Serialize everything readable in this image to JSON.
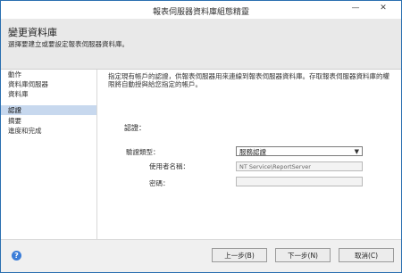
{
  "window": {
    "title": "報表伺服器資料庫組態精靈",
    "minimize_glyph": "—",
    "close_glyph": "✕"
  },
  "header": {
    "title": "變更資料庫",
    "subtitle": "選擇要建立或要設定報表伺服器資料庫。"
  },
  "steps": [
    {
      "label": "動作",
      "active": false
    },
    {
      "label": "資料庫伺服器",
      "active": false
    },
    {
      "label": "資料庫",
      "active": false
    },
    {
      "label": "認證",
      "active": true
    },
    {
      "label": "摘要",
      "active": false
    },
    {
      "label": "進度和完成",
      "active": false
    }
  ],
  "content": {
    "description": "指定現有帳戶的認證，供報表伺服器用來連線到報表伺服器資料庫。存取報表伺服器資料庫的權限將自動授與給您指定的帳戶。",
    "section_label": "認證：",
    "auth_type_label": "驗證類型：",
    "auth_type_value": "服務認證",
    "username_label": "使用者名稱：",
    "username_value": "NT Service\\ReportServer",
    "password_label": "密碼：",
    "password_value": ""
  },
  "footer": {
    "back_label": "上一步(B)",
    "next_label": "下一步(N)",
    "cancel_label": "取消(C)",
    "help_glyph": "?"
  }
}
